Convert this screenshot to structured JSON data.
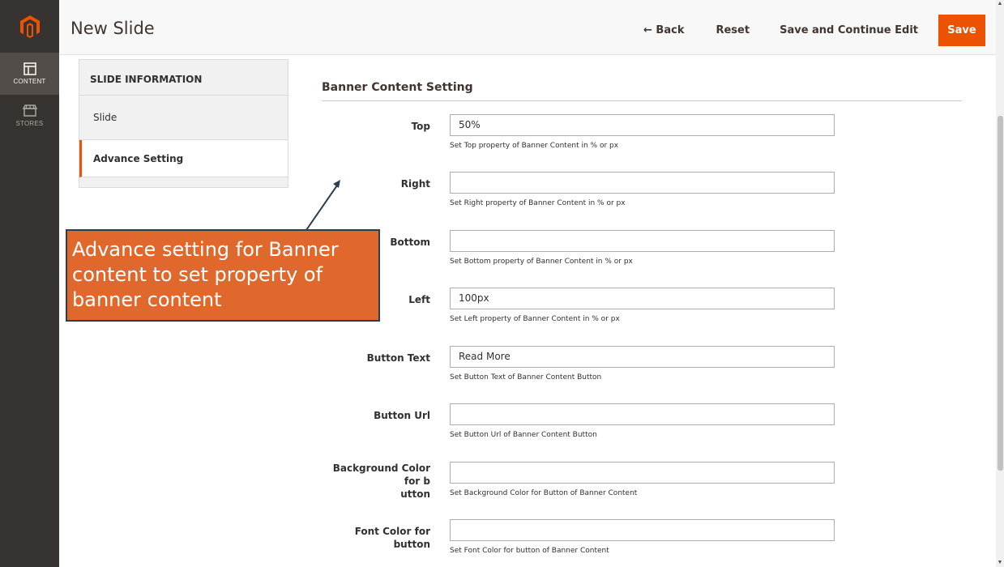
{
  "admin_menu": {
    "logo_icon": "magento-logo-icon",
    "items": [
      {
        "label": "CONTENT",
        "icon": "content-icon",
        "active": true
      },
      {
        "label": "STORES",
        "icon": "stores-icon",
        "active": false
      }
    ]
  },
  "header": {
    "title": "New Slide",
    "back_label": "← Back",
    "reset_label": "Reset",
    "save_continue_label": "Save and Continue Edit",
    "save_label": "Save"
  },
  "side_tabs": {
    "title": "SLIDE INFORMATION",
    "items": [
      {
        "label": "Slide",
        "active": false
      },
      {
        "label": "Advance Setting",
        "active": true
      }
    ]
  },
  "section": {
    "title": "Banner Content Setting",
    "fields": [
      {
        "label": "Top",
        "value": "50%",
        "note": "Set Top property of Banner Content in % or px"
      },
      {
        "label": "Right",
        "value": "",
        "note": "Set Right property of Banner Content in % or px"
      },
      {
        "label": "Bottom",
        "value": "",
        "note": "Set Bottom property of Banner Content in % or px"
      },
      {
        "label": "Left",
        "value": "100px",
        "note": "Set Left property of Banner Content in % or px"
      },
      {
        "label": "Button Text",
        "value": "Read More",
        "note": "Set Button Text of Banner Content Button"
      },
      {
        "label": "Button Url",
        "value": "",
        "note": "Set Button Url of Banner Content Button"
      },
      {
        "label_line1": "Background Color for b",
        "label_line2": "utton",
        "value": "",
        "note": "Set Background Color for Button of Banner Content"
      },
      {
        "label": "Font Color for button",
        "value": "",
        "note": "Set Font Color for button of Banner Content"
      }
    ]
  },
  "callout": {
    "text": "Advance setting for Banner content to set property of banner content"
  },
  "colors": {
    "accent": "#eb5202",
    "callout_bg": "#e0682c",
    "callout_border": "#2b3e4b",
    "menu_bg": "#373330"
  }
}
